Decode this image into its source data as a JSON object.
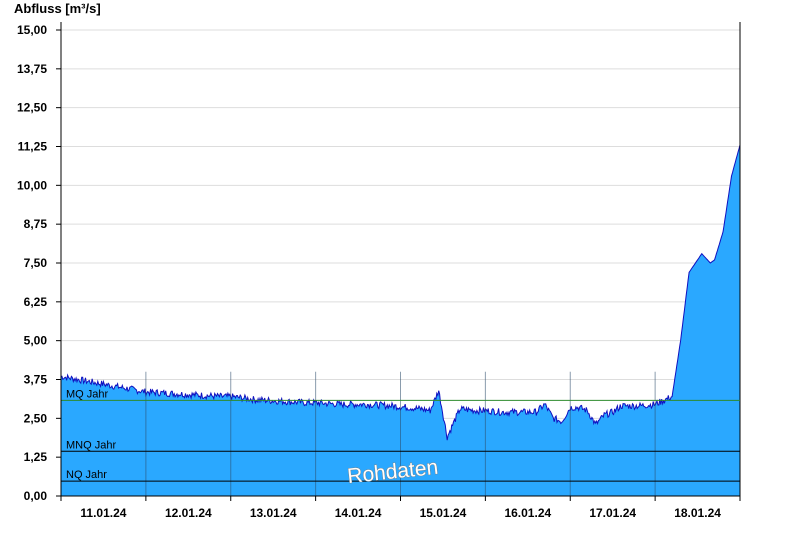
{
  "chart_data": {
    "type": "area",
    "ylabel": "Abfluss [m³/s]",
    "ylim": [
      0,
      15
    ],
    "y_ticks": [
      "0,00",
      "1,25",
      "2,50",
      "3,75",
      "5,00",
      "6,25",
      "7,50",
      "8,75",
      "10,00",
      "11,25",
      "12,50",
      "13,75",
      "15,00"
    ],
    "x_ticks": [
      "11.01.24",
      "12.01.24",
      "13.01.24",
      "14.01.24",
      "15.01.24",
      "16.01.24",
      "17.01.24",
      "18.01.24"
    ],
    "x_range_days": [
      0,
      8.0
    ],
    "series": [
      {
        "x": [
          0.0,
          0.3,
          0.6,
          0.9,
          1.0,
          1.3,
          1.6,
          1.9,
          2.0,
          2.3,
          2.6,
          2.9,
          3.0,
          3.3,
          3.6,
          3.9,
          4.1,
          4.25,
          4.35,
          4.45,
          4.55,
          4.7,
          4.9,
          5.0,
          5.2,
          5.4,
          5.6,
          5.7,
          5.8,
          5.9,
          6.0,
          6.1,
          6.2,
          6.3,
          6.4,
          6.5,
          6.6,
          6.8,
          7.0,
          7.2,
          7.3,
          7.4,
          7.55,
          7.65,
          7.7,
          7.8,
          7.9,
          8.0
        ],
        "y": [
          3.85,
          3.7,
          3.55,
          3.4,
          3.35,
          3.3,
          3.25,
          3.2,
          3.2,
          3.1,
          3.05,
          3.0,
          3.0,
          2.95,
          2.95,
          2.9,
          2.85,
          2.8,
          2.75,
          3.4,
          1.9,
          2.8,
          2.75,
          2.75,
          2.7,
          2.7,
          2.7,
          2.95,
          2.5,
          2.4,
          2.85,
          2.85,
          2.75,
          2.3,
          2.6,
          2.7,
          2.9,
          2.9,
          2.95,
          3.2,
          5.0,
          7.2,
          7.8,
          7.5,
          7.6,
          8.5,
          10.3,
          11.3
        ]
      }
    ],
    "reference_lines": [
      {
        "label": "MQ Jahr",
        "value": 3.08,
        "color": "#2e8b2e"
      },
      {
        "label": "MNQ Jahr",
        "value": 1.44,
        "color": "#000000"
      },
      {
        "label": "NQ Jahr",
        "value": 0.48,
        "color": "#000000"
      }
    ],
    "watermark": "Rohdaten",
    "colors": {
      "fill": "#2aa8ff",
      "line": "#1010c0",
      "grid": "#dddddd"
    }
  }
}
